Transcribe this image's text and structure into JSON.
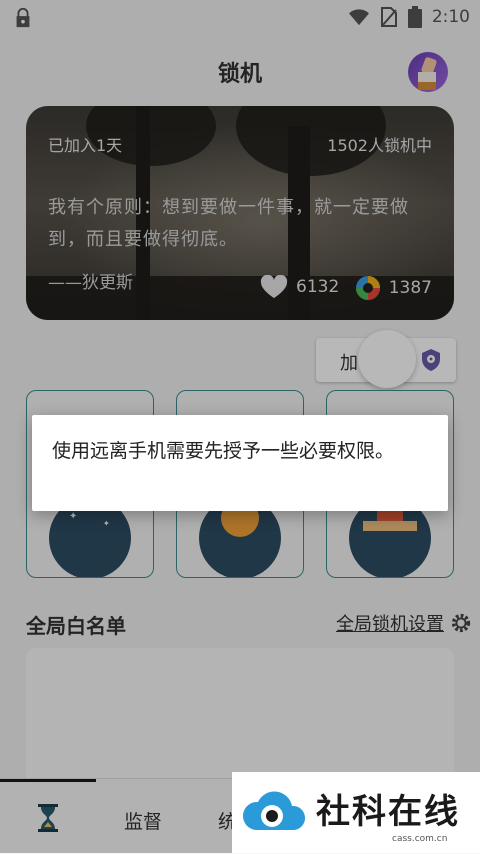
{
  "status_bar": {
    "time": "2:10",
    "icons": [
      "lock-icon",
      "wifi-icon",
      "no-sim-icon",
      "battery-icon"
    ]
  },
  "header": {
    "title": "锁机",
    "avatar": "avatar-hand-wave"
  },
  "hero_card": {
    "joined": "已加入1天",
    "online_count": "1502人锁机中",
    "quote": "我有个原则：想到要做一件事，就一定要做到，而且要做得彻底。",
    "author": "——狄更斯",
    "likes": "6132",
    "views": "1387"
  },
  "join_button": {
    "label": "加"
  },
  "mode_cards": [
    {
      "name": "mode-night",
      "color": "#2d4d63"
    },
    {
      "name": "mode-sun",
      "color": "#2d4d63"
    },
    {
      "name": "mode-desk",
      "color": "#2d4d63"
    }
  ],
  "whitelist": {
    "title": "全局白名单",
    "settings_link": "全局锁机设置"
  },
  "tabs": [
    {
      "label": "",
      "icon": "hourglass-icon"
    },
    {
      "label": "监督"
    },
    {
      "label": "统"
    }
  ],
  "dialog": {
    "message": "使用远离手机需要先授予一些必要权限。"
  },
  "watermark": {
    "text": "社科在线",
    "url": "cass.com.cn"
  },
  "colors": {
    "accent": "#3d8d8f",
    "overlay": "rgba(0,0,0,0.28)"
  }
}
